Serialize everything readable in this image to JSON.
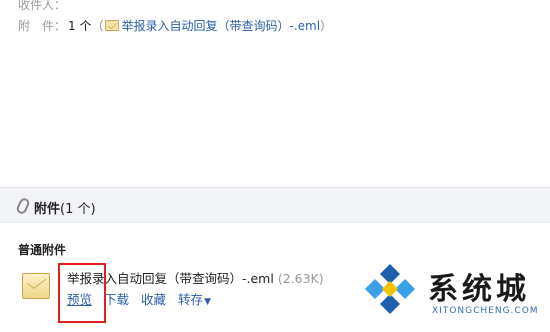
{
  "header": {
    "recipients_label": "收件人：",
    "attachment_label": "附　件：",
    "attachment_count": "1 个",
    "attachment_open": "（",
    "attachment_file": "举报录入自动回复（带查询码）-.eml",
    "attachment_close": "）"
  },
  "attachments_bar": {
    "title": "附件",
    "count": "(1 个)"
  },
  "section": {
    "title": "普通附件"
  },
  "file": {
    "name": "举报录入自动回复（带查询码）-.eml",
    "size": "(2.63K)",
    "actions": {
      "preview": "预览",
      "download": "下载",
      "save": "收藏",
      "forward": "转存"
    }
  },
  "watermark": {
    "text": "系统城",
    "sub": "XITONGCHENG.COM"
  },
  "colors": {
    "link": "#2d5fa8",
    "highlight": "#e02020",
    "bar_bg": "#f2f4f8"
  }
}
